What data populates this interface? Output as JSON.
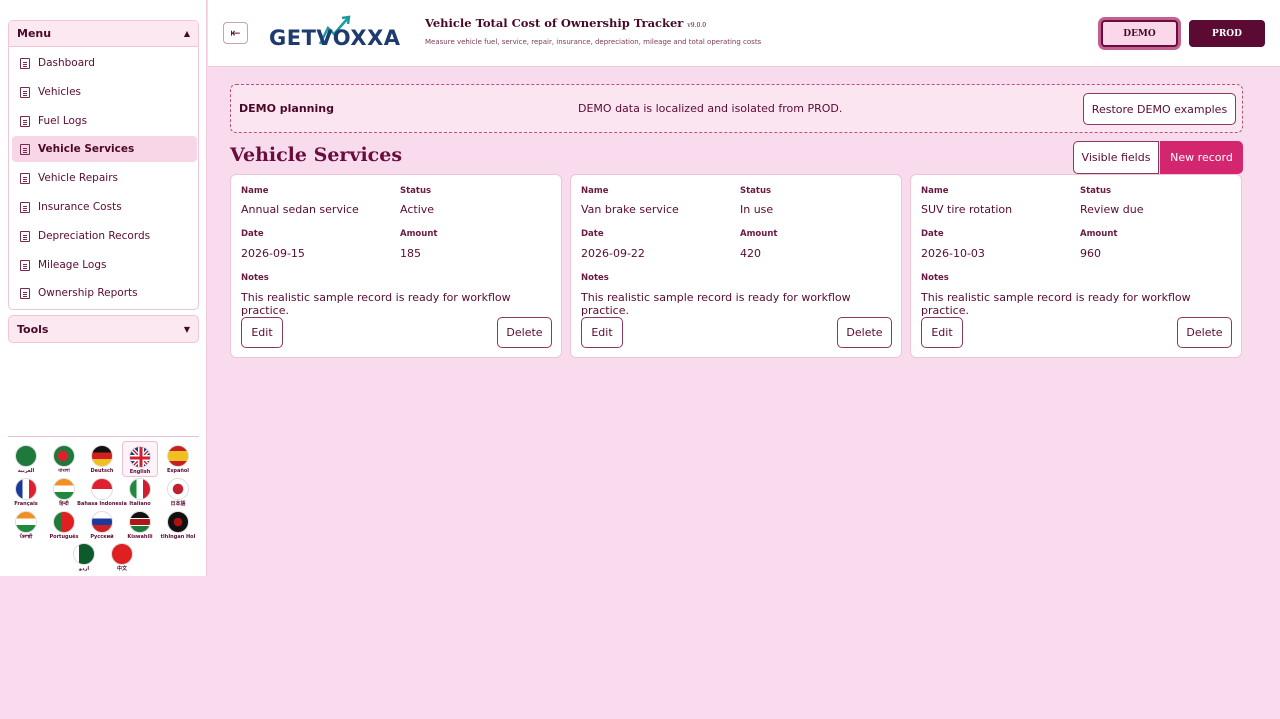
{
  "sidebar": {
    "menu_title": "Menu",
    "tools_title": "Tools",
    "items": [
      {
        "label": "Dashboard"
      },
      {
        "label": "Vehicles"
      },
      {
        "label": "Fuel Logs"
      },
      {
        "label": "Vehicle Services"
      },
      {
        "label": "Vehicle Repairs"
      },
      {
        "label": "Insurance Costs"
      },
      {
        "label": "Depreciation Records"
      },
      {
        "label": "Mileage Logs"
      },
      {
        "label": "Ownership Reports"
      }
    ],
    "languages": [
      {
        "label": "العربية"
      },
      {
        "label": "বাংলা"
      },
      {
        "label": "Deutsch"
      },
      {
        "label": "English"
      },
      {
        "label": "Español"
      },
      {
        "label": "Français"
      },
      {
        "label": "हिन्दी"
      },
      {
        "label": "Bahasa Indonesia"
      },
      {
        "label": "Italiano"
      },
      {
        "label": "日本語"
      },
      {
        "label": "ਪੰਜਾਬੀ"
      },
      {
        "label": "Português"
      },
      {
        "label": "Русский"
      },
      {
        "label": "Kiswahili"
      },
      {
        "label": "tlhIngan Hol"
      },
      {
        "label": "اردو"
      },
      {
        "label": "中文"
      }
    ]
  },
  "header": {
    "logo_text": "GETVOXXA",
    "title": "Vehicle Total Cost of Ownership Tracker",
    "version": "v9.0.0",
    "subtitle": "Measure vehicle fuel, service, repair, insurance, depreciation, mileage and total operating costs",
    "demo_label": "DEMO",
    "prod_label": "PROD"
  },
  "banner": {
    "title": "DEMO planning",
    "message": "DEMO data is localized and isolated from PROD.",
    "restore_label": "Restore DEMO examples"
  },
  "page": {
    "title": "Vehicle Services",
    "visible_fields_label": "Visible fields",
    "new_record_label": "New record"
  },
  "card_labels": {
    "name": "Name",
    "status": "Status",
    "date": "Date",
    "amount": "Amount",
    "notes": "Notes",
    "edit": "Edit",
    "delete": "Delete"
  },
  "records": [
    {
      "name": "Annual sedan service",
      "status": "Active",
      "date": "2026-09-15",
      "amount": "185",
      "notes": "This realistic sample record is ready for workflow practice."
    },
    {
      "name": "Van brake service",
      "status": "In use",
      "date": "2026-09-22",
      "amount": "420",
      "notes": "This realistic sample record is ready for workflow practice."
    },
    {
      "name": "SUV tire rotation",
      "status": "Review due",
      "date": "2026-10-03",
      "amount": "960",
      "notes": "This realistic sample record is ready for workflow practice."
    }
  ]
}
